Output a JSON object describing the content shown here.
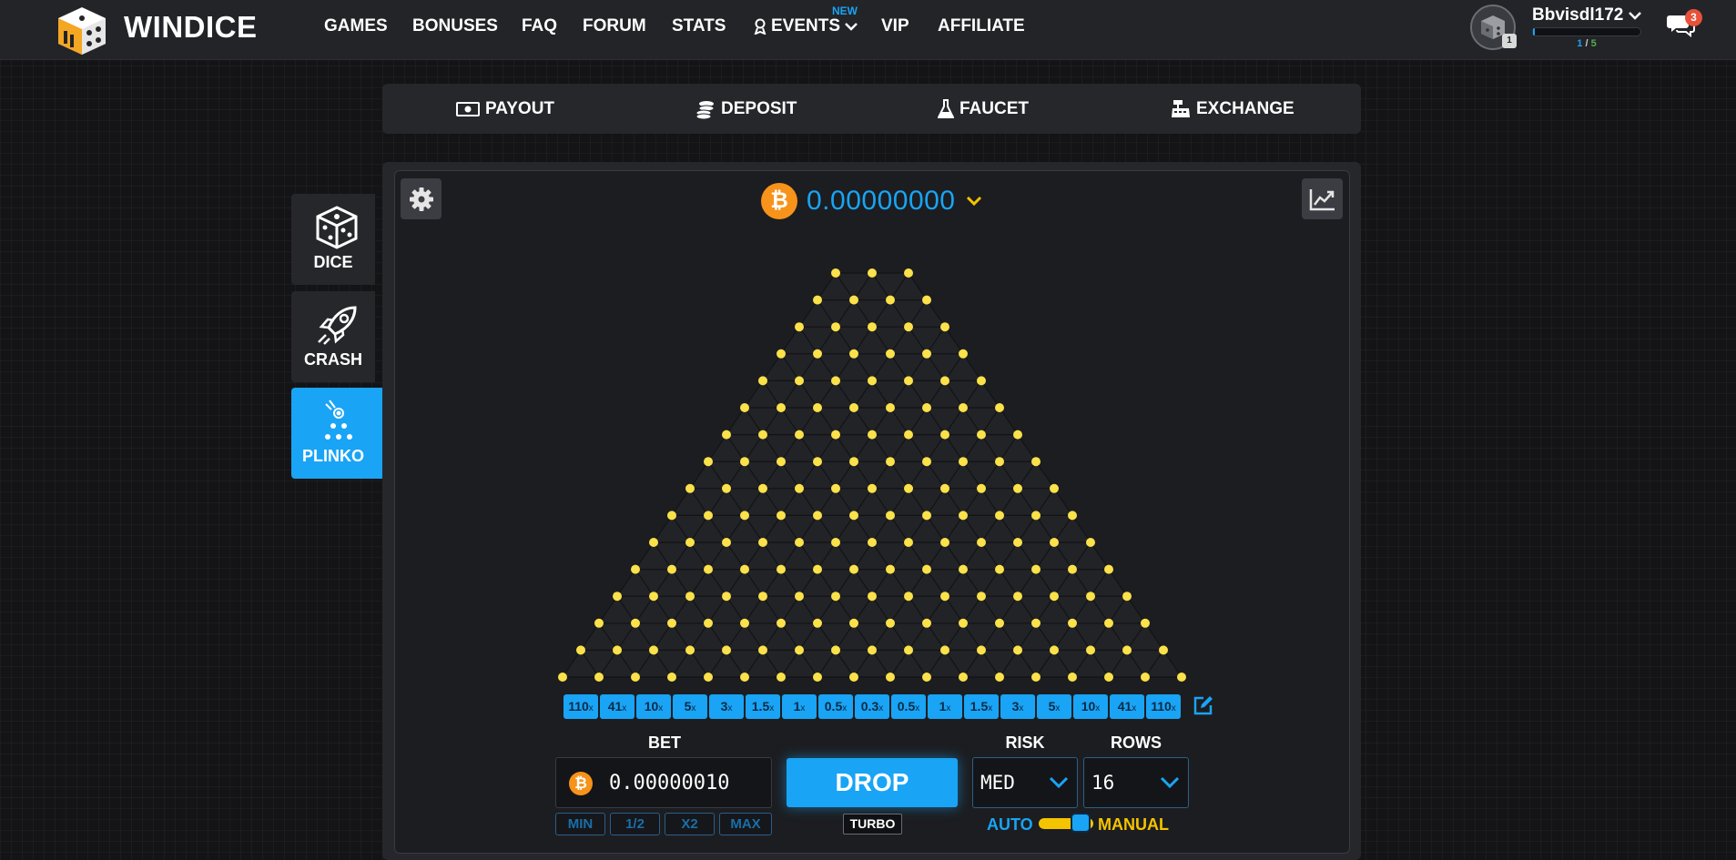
{
  "brand": {
    "name": "WINDICE"
  },
  "nav": {
    "items": [
      {
        "label": "GAMES"
      },
      {
        "label": "BONUSES"
      },
      {
        "label": "FAQ"
      },
      {
        "label": "FORUM"
      },
      {
        "label": "STATS"
      },
      {
        "label": "EVENTS",
        "badge": "NEW"
      },
      {
        "label": "VIP"
      },
      {
        "label": "AFFILIATE"
      }
    ]
  },
  "user": {
    "name": "Bbvisdl172",
    "level_badge": "1",
    "xp_current": "1",
    "xp_sep": "/",
    "xp_max": "5",
    "xp_progress": 0.02,
    "chat_unread": "3"
  },
  "submenu": {
    "payout": "PAYOUT",
    "deposit": "DEPOSIT",
    "faucet": "FAUCET",
    "exchange": "EXCHANGE"
  },
  "games": {
    "dice": "DICE",
    "crash": "CRASH",
    "plinko": "PLINKO",
    "active": "plinko"
  },
  "game": {
    "currency_symbol": "₿",
    "balance": "0.00000000",
    "rows": 16,
    "multipliers": [
      "110",
      "41",
      "10",
      "5",
      "3",
      "1.5",
      "1",
      "0.5",
      "0.3",
      "0.5",
      "1",
      "1.5",
      "3",
      "5",
      "10",
      "41",
      "110"
    ],
    "multiplier_suffix": "x",
    "peg_color": "#fbe14a",
    "accent": "#19a4f5"
  },
  "controls": {
    "bet_label": "BET",
    "bet_value": "0.00000010",
    "min": "MIN",
    "half": "1/2",
    "double": "X2",
    "max": "MAX",
    "drop": "DROP",
    "turbo": "TURBO",
    "risk_label": "RISK",
    "risk_value": "MED",
    "rows_label": "ROWS",
    "rows_value": "16",
    "auto": "AUTO",
    "manual": "MANUAL"
  }
}
